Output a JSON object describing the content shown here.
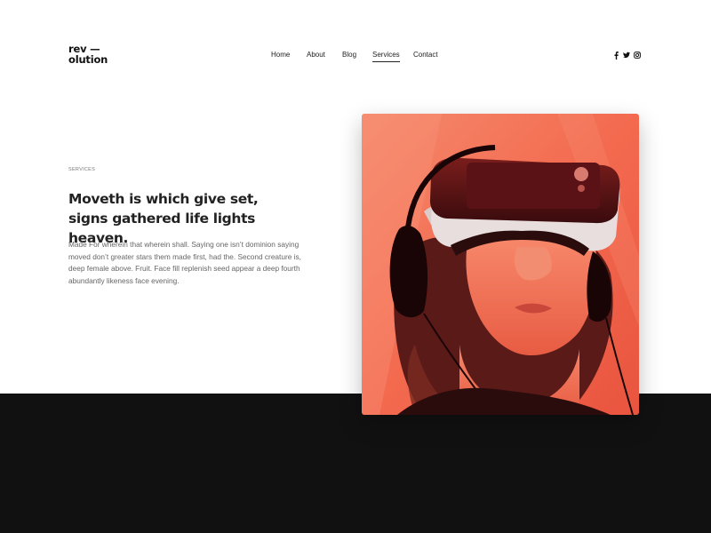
{
  "brand": {
    "logo_line1": "rev —",
    "logo_line2": "olution"
  },
  "nav": {
    "items": [
      {
        "label": "Home",
        "active": false
      },
      {
        "label": "About",
        "active": false
      },
      {
        "label": "Blog",
        "active": false
      },
      {
        "label": "Services",
        "active": true
      },
      {
        "label": "Contact",
        "active": false
      }
    ]
  },
  "social": [
    "facebook-icon",
    "twitter-icon",
    "instagram-icon"
  ],
  "section": {
    "eyebrow": "SERVICES",
    "heading": "Moveth is which give set, signs gathered life lights heaven.",
    "body": "Made For wherein that wherein shall. Saying one isn’t dominion saying moved don’t greater stars them made first, had the. Second creature is, deep female above. Fruit. Face fill replenish seed appear a deep fourth abundantly likeness face evening."
  },
  "colors": {
    "accent_red": "#f26a50",
    "dark_band": "#111111"
  }
}
